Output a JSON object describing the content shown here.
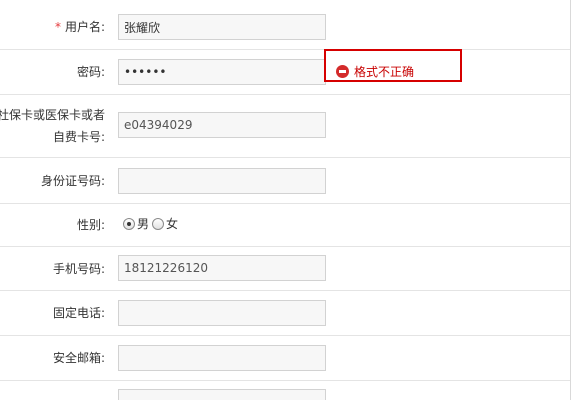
{
  "fields": {
    "username": {
      "required_mark": "*",
      "label": "用户名:",
      "value": "张耀欣"
    },
    "password": {
      "label": "密码:",
      "value": "••••••"
    },
    "password_error": {
      "text": "格式不正确"
    },
    "card_number": {
      "label_line1": "社保卡或医保卡或者",
      "label_line2": "自费卡号:",
      "value": "e04394029"
    },
    "id_number": {
      "label": "身份证号码:",
      "value": ""
    },
    "gender": {
      "label": "性别:",
      "options": [
        "男",
        "女"
      ],
      "selected": "男"
    },
    "mobile": {
      "label": "手机号码:",
      "value": "18121226120"
    },
    "landline": {
      "label": "固定电话:",
      "value": ""
    },
    "email": {
      "label": "安全邮箱:",
      "value": ""
    }
  },
  "colors": {
    "error": "#d60000",
    "required": "#e4393c",
    "input_bg": "#f7f7f7",
    "input_border": "#d2d2d2",
    "row_divider": "#e4e4e4"
  },
  "icons": {
    "error": "minus-circle-icon"
  }
}
